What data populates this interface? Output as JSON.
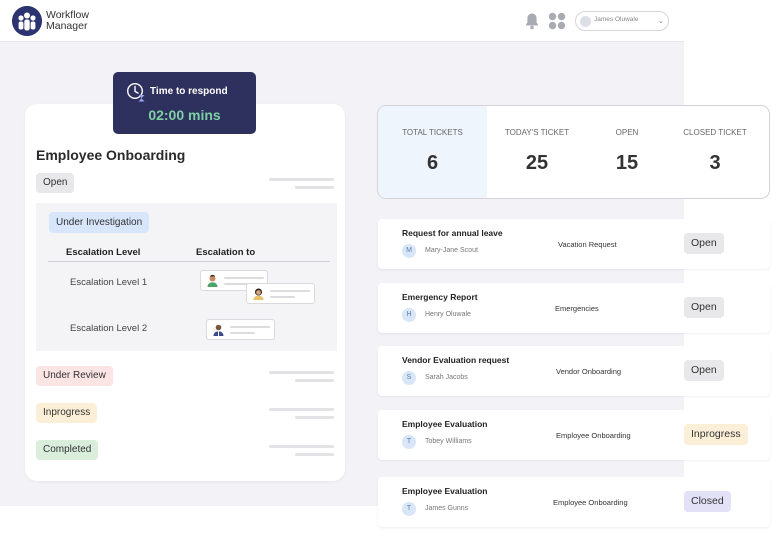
{
  "header": {
    "brand_line1": "Workflow",
    "brand_line2": "Manager",
    "user_name": "James Oluwale"
  },
  "timer": {
    "label": "Time to respond",
    "value": "02:00 mins"
  },
  "onboarding": {
    "title": "Employee Onboarding",
    "status_open": "Open",
    "investigation": {
      "label": "Under Investigation",
      "col_level": "Escalation Level",
      "col_to": "Escalation to",
      "levels": [
        "Escalation Level 1",
        "Escalation Level 2"
      ]
    },
    "status_review": "Under Review",
    "status_progress": "Inprogress",
    "status_completed": "Completed"
  },
  "stats": [
    {
      "label": "TOTAL TICKETS",
      "value": "6"
    },
    {
      "label": "TODAY'S TICKET",
      "value": "25"
    },
    {
      "label": "OPEN",
      "value": "15"
    },
    {
      "label": "CLOSED TICKET",
      "value": "3"
    }
  ],
  "tickets": [
    {
      "title": "Request for annual leave",
      "initial": "M",
      "person": "Mary-Jane Scout",
      "category": "Vacation Request",
      "status": "Open"
    },
    {
      "title": "Emergency Report",
      "initial": "H",
      "person": "Henry Oluwale",
      "category": "Emergencies",
      "status": "Open"
    },
    {
      "title": "Vendor Evaluation request",
      "initial": "S",
      "person": "Sarah Jacobs",
      "category": "Vendor Onboarding",
      "status": "Open"
    },
    {
      "title": "Employee Evaluation",
      "initial": "T",
      "person": "Tobey Williams",
      "category": "Employee Onboarding",
      "status": "Inprogress"
    },
    {
      "title": "Employee Evaluation",
      "initial": "T",
      "person": "James Gunns",
      "category": "Employee Onboarding",
      "status": "Closed"
    }
  ],
  "colors": {
    "brand": "#2b3470",
    "timer_bg": "#2e315e",
    "timer_value": "#7ed0a4",
    "status_open": "#e8e8ea",
    "status_progress": "#fcefd7",
    "status_closed": "#e3e1f8",
    "investigation": "#d7e6fb",
    "review": "#fbe4e4",
    "completed": "#d9efdc"
  }
}
